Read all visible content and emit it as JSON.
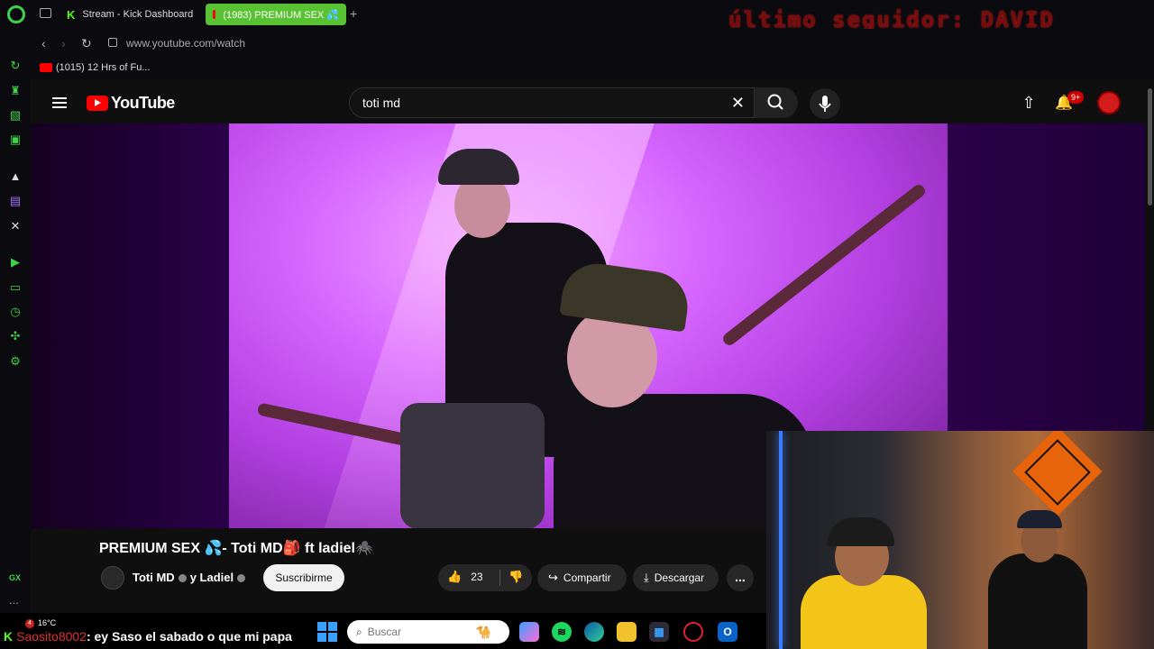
{
  "browser": {
    "tabs": [
      {
        "label": "Stream - Kick Dashboard",
        "favicon": "K"
      },
      {
        "label": "(1983) PREMIUM SEX 💦",
        "active": true
      }
    ],
    "new_tab": "+",
    "url": "www.youtube.com/watch",
    "bookmarks": [
      {
        "label": "(1015) 12 Hrs of Fu..."
      }
    ]
  },
  "stream_overlay": {
    "follower_text": "último seguidor: DAVID",
    "chat": {
      "platform_icon": "K",
      "username": "Saosito8002",
      "message": ": ey Saso el sabado o que mi papa"
    },
    "weather": {
      "badge": "4",
      "temperature": "16°C"
    }
  },
  "sidebar": {
    "gx_label": "GX",
    "more": "..."
  },
  "youtube": {
    "logo_text": "YouTube",
    "search": {
      "query": "toti md"
    },
    "notifications_badge": "9+",
    "video": {
      "title": "PREMIUM SEX 💦- Toti MD🎒 ft ladiel🕷️",
      "channel_1": "Toti MD",
      "channel_joiner": "y",
      "channel_2": "Ladiel",
      "subscribe_label": "Suscribirme",
      "likes": "23",
      "share_label": "Compartir",
      "download_label": "Descargar",
      "more": "..."
    }
  },
  "taskbar": {
    "search_placeholder": "Buscar"
  },
  "colors": {
    "opera_green": "#3fd14a",
    "kick_green": "#53fc18",
    "youtube_red": "#ff0000",
    "active_tab": "#58c233",
    "video_purple": "#d766ff"
  }
}
